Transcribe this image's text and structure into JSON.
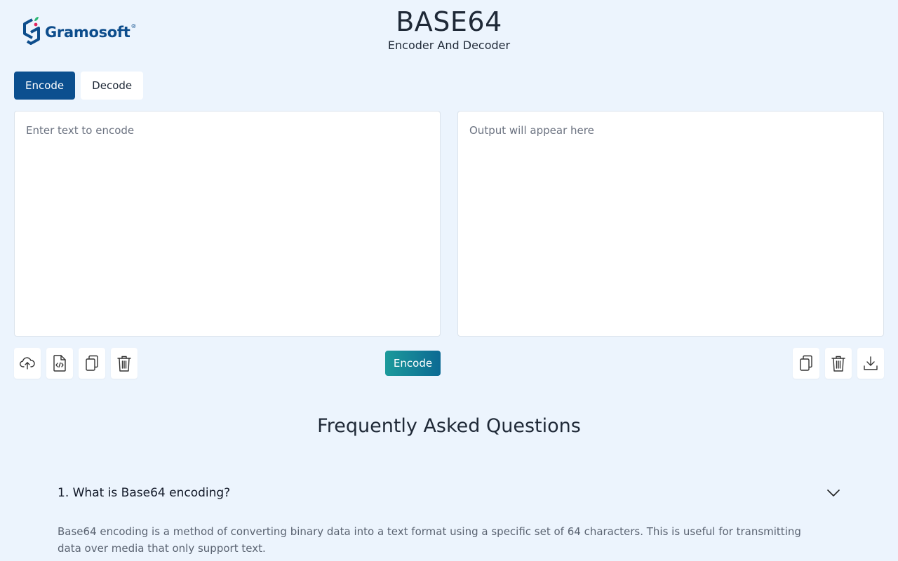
{
  "brand": {
    "name": "Gramosoft",
    "registered": "®"
  },
  "header": {
    "title": "BASE64",
    "subtitle": "Encoder And Decoder"
  },
  "tabs": [
    {
      "label": "Encode",
      "active": true
    },
    {
      "label": "Decode",
      "active": false
    }
  ],
  "input": {
    "placeholder": "Enter text to encode",
    "value": ""
  },
  "output": {
    "placeholder": "Output will appear here",
    "value": ""
  },
  "left_toolbar": [
    "upload-icon",
    "code-file-icon",
    "copy-icon",
    "trash-icon"
  ],
  "encode_button": {
    "label": "Encode"
  },
  "right_toolbar": [
    "copy-icon",
    "trash-icon",
    "download-icon"
  ],
  "faq": {
    "title": "Frequently Asked Questions",
    "items": [
      {
        "question": "1. What is Base64 encoding?",
        "answer": "Base64 encoding is a method of converting binary data into a text format using a specific set of 64 characters. This is useful for transmitting data over media that only support text.",
        "expanded": true
      }
    ]
  },
  "colors": {
    "background": "#ecf4fd",
    "primary": "#0b4f8f",
    "accent_gradient_start": "#1c9a9b",
    "accent_gradient_end": "#0c6a93",
    "logo_leaf": "#2bb673"
  }
}
